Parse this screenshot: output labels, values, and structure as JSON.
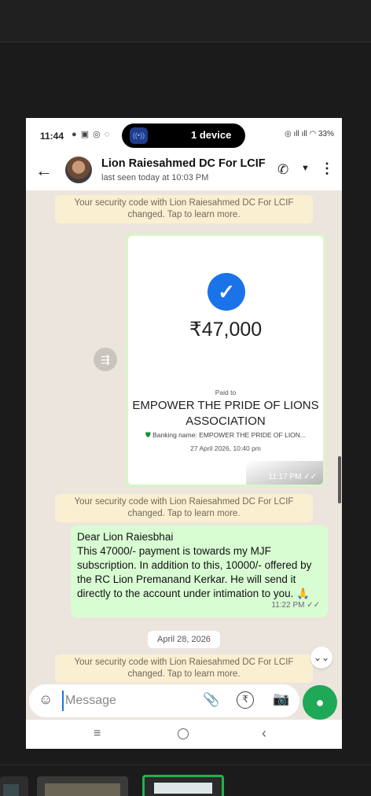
{
  "status_bar": {
    "time": "11:44",
    "left_icons": "● ▣ ◎ ◌",
    "dynamic_island_label": "1 device",
    "right_status": "◎ ıll ıll ◠ 33%"
  },
  "header": {
    "contact_name": "Lion Raiesahmed DC For LCIF",
    "last_seen": "last seen today at 10:03 PM"
  },
  "messages": {
    "security_notice_1": "Your security code with Lion Raiesahmed DC For LCIF changed. Tap to learn more.",
    "payment": {
      "amount": "₹47,000",
      "paid_to_label": "Paid to",
      "payee": "EMPOWER THE PRIDE OF LIONS ASSOCIATION",
      "banking_name": "Banking name: EMPOWER THE PRIDE OF LION...",
      "date": "27 April 2026, 10:40 pm",
      "time": "11:17 PM ✓✓"
    },
    "security_notice_2": "Your security code with Lion Raiesahmed DC For LCIF changed. Tap to learn more.",
    "outgoing": {
      "text": "Dear Lion Raiesbhai\nThis 47000/-  payment is towards my MJF subscription. In addition to this, 10000/- offered by the RC Lion Premanand Kerkar. He will send it directly to the account under intimation to you. 🙏",
      "time": "11:22 PM ✓✓"
    },
    "date_chip": "April 28, 2026",
    "security_notice_3": "Your security code with Lion Raiesahmed DC For LCIF changed. Tap to learn more."
  },
  "composer": {
    "placeholder": "Message"
  },
  "icons": {
    "back": "←",
    "call": "📞",
    "menu": "⋮",
    "check": "✓",
    "forward": "⇶",
    "scroll_down": "⌄⌄",
    "emoji": "☺",
    "attach": "⌀",
    "rupee": "₹",
    "camera": "◉",
    "mic": "🎤",
    "nav_recent": "≡",
    "nav_back": "‹"
  }
}
